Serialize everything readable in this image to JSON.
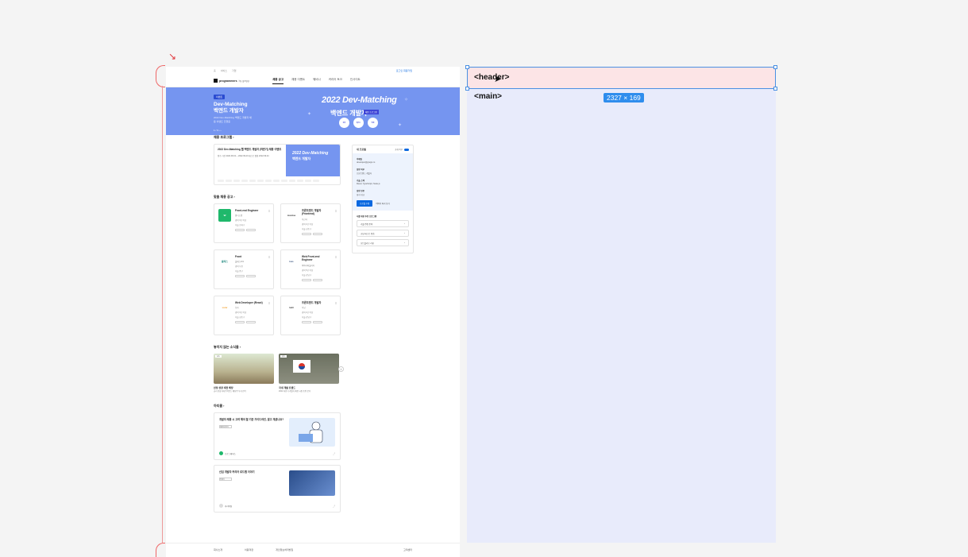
{
  "utility": {
    "left": [
      "홈",
      "서비스",
      "기업"
    ],
    "right": "로그인 회원가입"
  },
  "logo": {
    "name": "programmers",
    "sub": "by grepp"
  },
  "nav": [
    "채용 공고",
    "채용 이벤트",
    "웨비나",
    "커리어 토크",
    "인사이트"
  ],
  "hero": {
    "badge": "이벤트",
    "title_line1": "Dev-Matching",
    "title_line2": "백엔드 개발자",
    "desc": "2022 Dev-Matching 백엔드 개발자 채용 이벤트 진행중",
    "pager": "1 / 3  ‹ ›",
    "big_title": "2022 Dev-Matching",
    "big_sub": "백엔드 개발자",
    "tag": "채용 프로그램",
    "circles": [
      "접수",
      "테스트",
      "면접"
    ]
  },
  "program": {
    "section": "채용 프로그램 ›",
    "title": "2022 Dev-Matching 웹 백엔드 개발자 (하반기) 채용 이벤트",
    "meta": "접수 기간 2022.09.01 ~ 2022.09.20 테스트 일정 2022.09.24",
    "thumb_title": "2022 Dev-Matching",
    "thumb_sub": "백엔드 개발자"
  },
  "jobs_section": "맞춤 채용 공고 ›",
  "jobs": [
    {
      "logo": "W",
      "logo_color": "#1fb86b",
      "title": "Front-end Engineer",
      "company": "원티드랩",
      "line1": "경력 3년 이상",
      "line2": "서울 송파구"
    },
    {
      "logo": "musinsa",
      "logo_color": "#ffffff",
      "title": "프론트엔드 개발자 (Frontend)",
      "company": "무신사",
      "line1": "경력 2년 이상",
      "line2": "서울 성동구"
    },
    {
      "logo": "클래스",
      "logo_color": "#ffffff",
      "title": "Front",
      "company": "클래스101",
      "line1": "경력 무관",
      "line2": "서울 중구"
    },
    {
      "logo": "toss",
      "logo_color": "#ffffff",
      "title": "Web Front-end Engineer",
      "company": "비바리퍼블리카",
      "line1": "경력 5년 이상",
      "line2": "서울 강남구"
    },
    {
      "logo": "socar",
      "logo_color": "#ffffff",
      "title": "Web Developer (React)",
      "company": "쏘카",
      "line1": "경력 3년 이상",
      "line2": "서울 성동구"
    },
    {
      "logo": "lunit",
      "logo_color": "#ffffff",
      "title": "프론트엔드 개발자",
      "company": "루닛",
      "line1": "경력 2년 이상",
      "line2": "서울 강남구"
    }
  ],
  "cards_section": "놓치지 않는 소식들 ›",
  "cards": [
    {
      "label": "뉴스",
      "title": "안정 성장 세전 배당",
      "desc": "금리 인상기에 주목받는 배당주 투자 전략"
    },
    {
      "label": "뉴스",
      "title": "국내 개발 트렌드",
      "desc": "2022 하반기 개발자 채용 시장 동향 분석"
    }
  ],
  "articles_section": "아티클 ›",
  "articles": [
    {
      "title": "개발자 채용 시 고려 해야 할 기준 가이드라인, 알고 계셨나요?",
      "tag": "채용인사이트",
      "author": "프로그래머스"
    },
    {
      "title": "신입 개발자 커리어 로드맵 이야기",
      "tag": "커리어",
      "author": "커리어팀"
    }
  ],
  "side": {
    "title": "내 프로필",
    "toggle": "공개 여부",
    "rows": [
      {
        "k": "이메일",
        "v": "developer@grepp.co"
      },
      {
        "k": "희망 직무",
        "v": "프론트엔드 개발자"
      },
      {
        "k": "기술 스택",
        "v": "React, TypeScript, Node.js"
      },
      {
        "k": "희망 연봉",
        "v": "회사 내규"
      }
    ],
    "btn_primary": "프로필 수정",
    "btn_secondary": "이력서 미리 보기",
    "rec_title": "나를 위한 추천 프로그램",
    "rec_items": [
      "기술 면접 준비",
      "코딩 테스트 연습",
      "포트폴리오 리뷰"
    ]
  },
  "footer": [
    "회사소개",
    "이용약관",
    "개인정보처리방침",
    "고객센터"
  ],
  "inspector": {
    "header_tag": "<header>",
    "main_tag": "<main>",
    "dimension": "2327 × 169"
  }
}
